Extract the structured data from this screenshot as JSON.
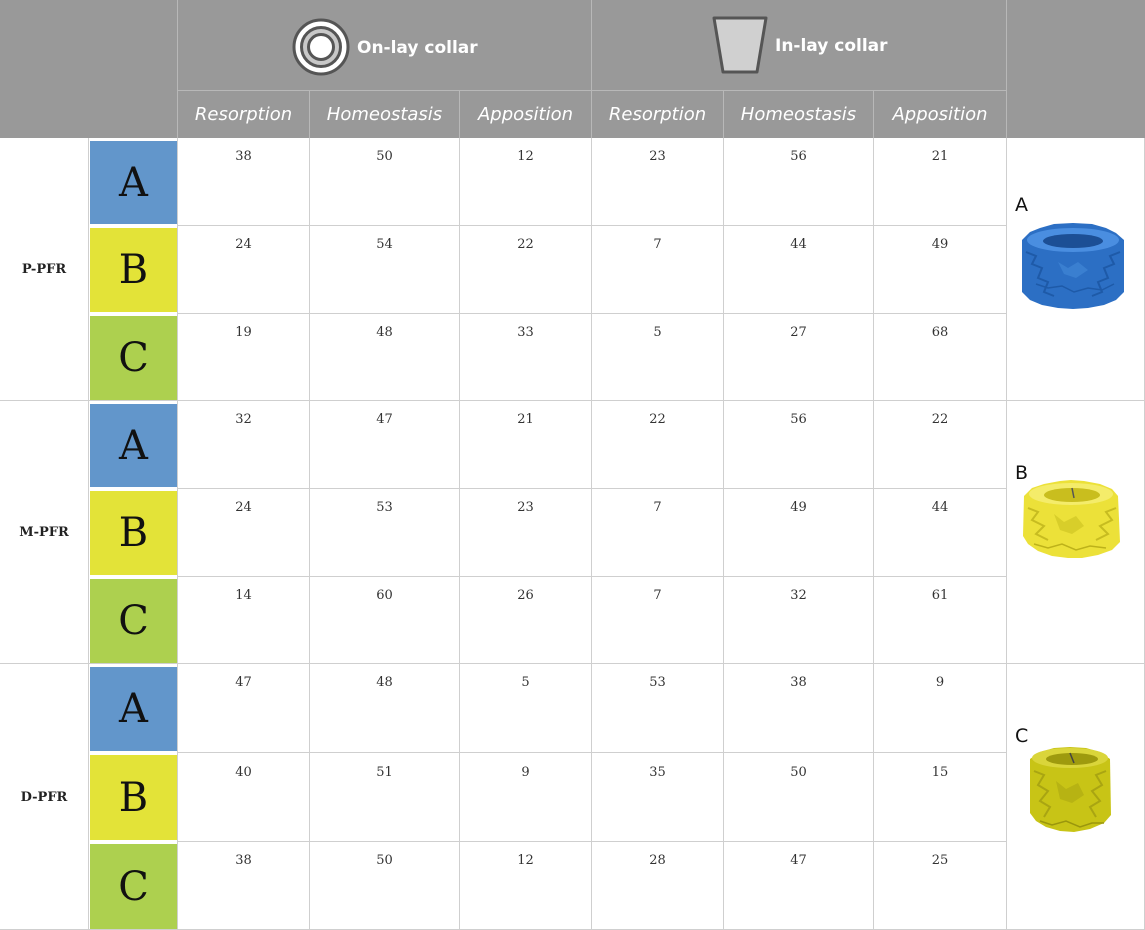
{
  "colors": {
    "header_bg": "#999999",
    "A": "#6296CB",
    "B": "#E3E338",
    "C": "#ADD04F",
    "model_A": "#2C6FC4",
    "model_B": "#ECE139",
    "model_C": "#C8C416"
  },
  "header": {
    "onlay": {
      "icon": "ring-icon",
      "label": "On-lay collar"
    },
    "inlay": {
      "icon": "trapezoid-icon",
      "label": "In-lay collar"
    },
    "subheaders": [
      "Resorption",
      "Homeostasis",
      "Apposition",
      "Resorption",
      "Homeostasis",
      "Apposition"
    ]
  },
  "groups": [
    {
      "label": "P-PFR",
      "rows": [
        {
          "letter": "A",
          "values": [
            "38",
            "50",
            "12",
            "23",
            "56",
            "21"
          ]
        },
        {
          "letter": "B",
          "values": [
            "24",
            "54",
            "22",
            "7",
            "44",
            "49"
          ]
        },
        {
          "letter": "C",
          "values": [
            "19",
            "48",
            "33",
            "5",
            "27",
            "68"
          ]
        }
      ],
      "model": {
        "label": "A",
        "icon": "blue-collar-model"
      }
    },
    {
      "label": "M-PFR",
      "rows": [
        {
          "letter": "A",
          "values": [
            "32",
            "47",
            "21",
            "22",
            "56",
            "22"
          ]
        },
        {
          "letter": "B",
          "values": [
            "24",
            "53",
            "23",
            "7",
            "49",
            "44"
          ]
        },
        {
          "letter": "C",
          "values": [
            "14",
            "60",
            "26",
            "7",
            "32",
            "61"
          ]
        }
      ],
      "model": {
        "label": "B",
        "icon": "yellow-collar-model"
      }
    },
    {
      "label": "D-PFR",
      "rows": [
        {
          "letter": "A",
          "values": [
            "47",
            "48",
            "5",
            "53",
            "38",
            "9"
          ]
        },
        {
          "letter": "B",
          "values": [
            "40",
            "51",
            "9",
            "35",
            "50",
            "15"
          ]
        },
        {
          "letter": "C",
          "values": [
            "38",
            "50",
            "12",
            "28",
            "47",
            "25"
          ]
        }
      ],
      "model": {
        "label": "C",
        "icon": "olive-collar-model"
      }
    }
  ]
}
